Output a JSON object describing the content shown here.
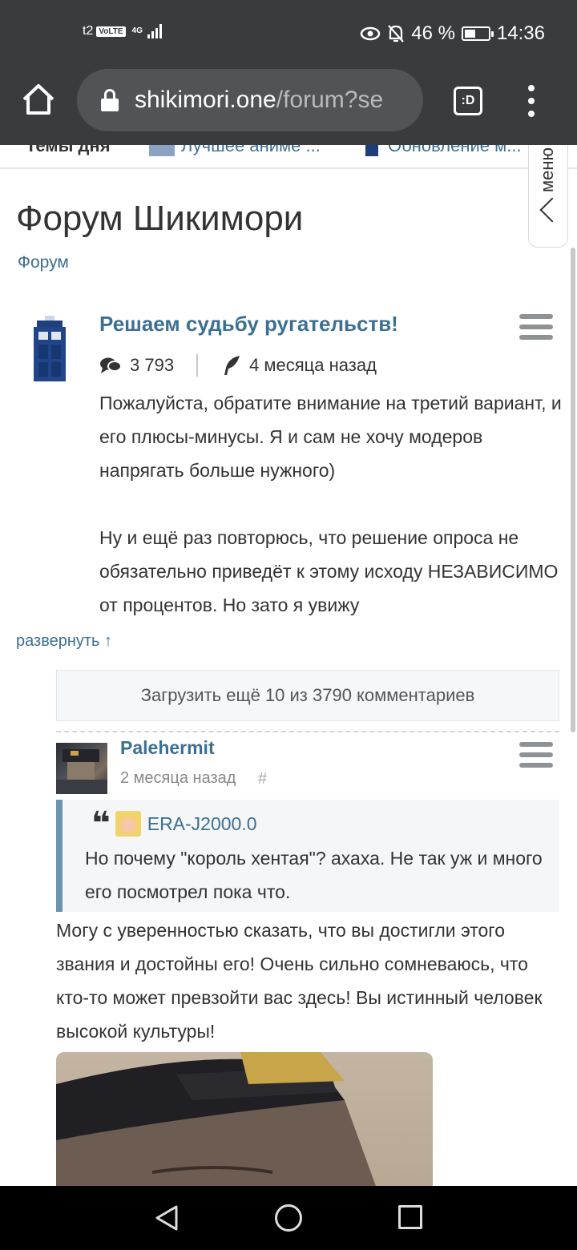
{
  "status_bar": {
    "carrier": "t2",
    "volte": "VoLTE",
    "network": "4G",
    "battery_percent": "46 %",
    "battery_level": 0.46,
    "time": "14:36"
  },
  "browser": {
    "url_host": "shikimori.one",
    "url_path": "/forum?se",
    "tab_button_label": ":D"
  },
  "topics_strip": {
    "label": "Темы дня",
    "items": [
      "Лучшее аниме ...",
      "Обновление м..."
    ]
  },
  "menu_tab": {
    "label": "меню"
  },
  "page": {
    "title": "Форум Шикимори",
    "breadcrumb": "Форум"
  },
  "topic": {
    "title": "Решаем судьбу ругательств!",
    "comment_count": "3 793",
    "last_updated": "4 месяца назад",
    "body_paragraphs": [
      "Пожалуйста, обратите внимание на третий вариант, и его плюсы-минусы. Я и сам не хочу модеров напрягать больше нужного)",
      "Ну и ещё раз повторюсь, что решение опроса не обязательно приведёт к этому исходу НЕЗАВИСИМО от процентов. Но зато я увижу"
    ],
    "expand_label": "развернуть ↑"
  },
  "load_more": {
    "label": "Загрузить ещё 10 из 3790 комментариев"
  },
  "comment": {
    "author": "Palehermit",
    "time": "2 месяца назад",
    "permalink": "#",
    "quote": {
      "marks": "❛❛",
      "author": "ERA-J2000.0",
      "text": "Но почему \"король хентая\"? ахаха. Не так уж и много его посмотрел пока что."
    },
    "text": "Могу с уверенностью сказать, что вы достигли этого звания и достойны его! Очень сильно сомневаюсь, что кто-то может превзойти вас здесь! Вы истинный человек высокой культуры!"
  },
  "colors": {
    "link": "#3d6f93",
    "chrome": "#3a3b3d",
    "quote_border": "#6a94b0"
  }
}
